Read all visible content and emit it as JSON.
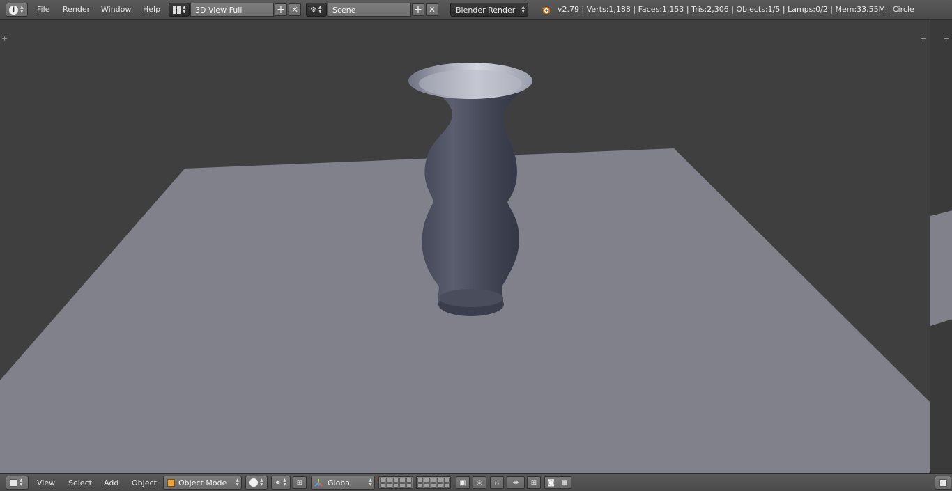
{
  "top_header": {
    "menus": [
      "File",
      "Render",
      "Window",
      "Help"
    ],
    "screen_layout": "3D View Full",
    "scene": "Scene",
    "render_engine": "Blender Render",
    "stats": "v2.79 | Verts:1,188 | Faces:1,153 | Tris:2,306 | Objects:1/5 | Lamps:0/2 | Mem:33.55M | Circle"
  },
  "bottom_header": {
    "menus": [
      "View",
      "Select",
      "Add",
      "Object"
    ],
    "mode": "Object Mode",
    "orientation": "Global"
  },
  "viewport": {
    "background_color": "#3f3f3f",
    "plane_color": "#7f8089",
    "vase_color": "#4b4e5c"
  },
  "icons": {
    "info": "info-icon",
    "layout": "screen-layout-icon",
    "scene": "scene-icon",
    "blender": "blender-logo-icon"
  }
}
